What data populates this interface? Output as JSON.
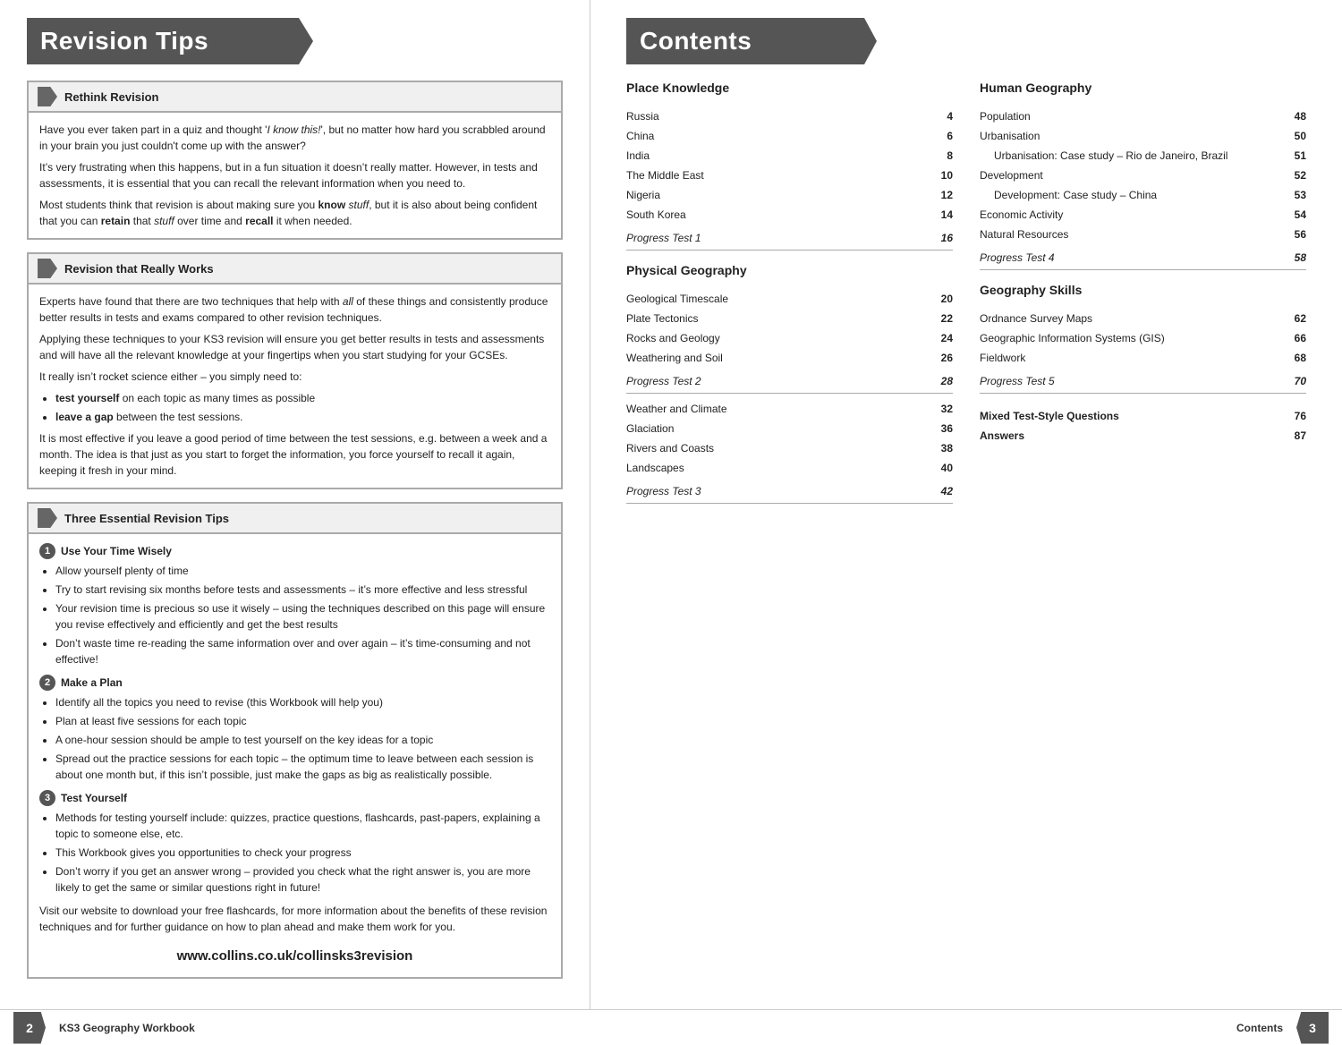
{
  "left_page": {
    "header_title": "Revision Tips",
    "section1": {
      "title": "Rethink Revision",
      "paragraphs": [
        "Have you ever taken part in a quiz and thought ‘I know this!’, but no matter how hard you scrabbled around in your brain you just couldn’t come up with the answer?",
        "It’s very frustrating when this happens, but in a fun situation it doesn’t really matter. However, in tests and assessments, it is essential that you can recall the relevant information when you need to.",
        "Most students think that revision is about making sure you know stuff, but it is also about being confident that you can retain that stuff over time and recall it when needed."
      ]
    },
    "section2": {
      "title": "Revision that Really Works",
      "paragraphs": [
        "Experts have found that there are two techniques that help with all of these things and consistently produce better results in tests and exams compared to other revision techniques.",
        "Applying these techniques to your KS3 revision will ensure you get better results in tests and assessments and will have all the relevant knowledge at your fingertips when you start studying for your GCSEs.",
        "It really isn’t rocket science either – you simply need to:"
      ],
      "bullets": [
        "test yourself on each topic as many times as possible",
        "leave a gap between the test sessions."
      ],
      "paragraph_after": "It is most effective if you leave a good period of time between the test sessions, e.g. between a week and a month. The idea is that just as you start to forget the information, you force yourself to recall it again, keeping it fresh in your mind."
    },
    "section3": {
      "title": "Three Essential Revision Tips",
      "tips": [
        {
          "number": "1",
          "title": "Use Your Time Wisely",
          "bullets": [
            "Allow yourself plenty of time",
            "Try to start revising six months before tests and assessments – it’s more effective and less stressful",
            "Your revision time is precious so use it wisely – using the techniques described on this page will ensure you revise effectively and efficiently and get the best results",
            "Don’t waste time re-reading the same information over and over again – it’s time-consuming and not effective!"
          ]
        },
        {
          "number": "2",
          "title": "Make a Plan",
          "bullets": [
            "Identify all the topics you need to revise (this Workbook will help you)",
            "Plan at least five sessions for each topic",
            "A one-hour session should be ample to test yourself on the key ideas for a topic",
            "Spread out the practice sessions for each topic – the optimum time to leave between each session is about one month but, if this isn’t possible, just make the gaps as big as realistically possible."
          ]
        },
        {
          "number": "3",
          "title": "Test Yourself",
          "bullets": [
            "Methods for testing yourself include: quizzes, practice questions, flashcards, past-papers, explaining a topic to someone else, etc.",
            "This Workbook gives you opportunities to check your progress",
            "Don’t worry if you get an answer wrong – provided you check what the right answer is, you are more likely to get the same or similar questions right in future!"
          ]
        }
      ],
      "footer_text": "Visit our website to download your free flashcards, for more information about the benefits of these revision techniques and for further guidance on how to plan ahead and make them work for you.",
      "website": "www.collins.co.uk/collinsks3revision"
    }
  },
  "right_page": {
    "header_title": "Contents",
    "col_left": {
      "section1_title": "Place Knowledge",
      "place_knowledge_items": [
        {
          "name": "Russia",
          "page": "4"
        },
        {
          "name": "China",
          "page": "6"
        },
        {
          "name": "India",
          "page": "8"
        },
        {
          "name": "The Middle East",
          "page": "10"
        },
        {
          "name": "Nigeria",
          "page": "12"
        },
        {
          "name": "South Korea",
          "page": "14"
        }
      ],
      "progress_test_1": {
        "name": "Progress Test 1",
        "page": "16"
      },
      "section2_title": "Physical Geography",
      "physical_geo_items": [
        {
          "name": "Geological Timescale",
          "page": "20"
        },
        {
          "name": "Plate Tectonics",
          "page": "22"
        },
        {
          "name": "Rocks and Geology",
          "page": "24"
        },
        {
          "name": "Weathering and Soil",
          "page": "26"
        }
      ],
      "progress_test_2": {
        "name": "Progress Test 2",
        "page": "28"
      },
      "physical_geo_items2": [
        {
          "name": "Weather and Climate",
          "page": "32"
        },
        {
          "name": "Glaciation",
          "page": "36"
        },
        {
          "name": "Rivers and Coasts",
          "page": "38"
        },
        {
          "name": "Landscapes",
          "page": "40"
        }
      ],
      "progress_test_3": {
        "name": "Progress Test 3",
        "page": "42"
      }
    },
    "col_right": {
      "section1_title": "Human Geography",
      "human_geo_items": [
        {
          "name": "Population",
          "page": "48"
        },
        {
          "name": "Urbanisation",
          "page": "50"
        },
        {
          "name": "Urbanisation: Case study – Rio de Janeiro, Brazil",
          "page": "51",
          "indented": true
        },
        {
          "name": "Development",
          "page": "52"
        },
        {
          "name": "Development: Case study – China",
          "page": "53",
          "indented": true
        },
        {
          "name": "Economic Activity",
          "page": "54"
        },
        {
          "name": "Natural Resources",
          "page": "56"
        }
      ],
      "progress_test_4": {
        "name": "Progress Test 4",
        "page": "58"
      },
      "section2_title": "Geography Skills",
      "geo_skills_items": [
        {
          "name": "Ordnance Survey Maps",
          "page": "62"
        },
        {
          "name": "Geographic Information Systems (GIS)",
          "page": "66"
        },
        {
          "name": "Fieldwork",
          "page": "68"
        }
      ],
      "progress_test_5": {
        "name": "Progress Test 5",
        "page": "70"
      },
      "mixed_title": "Mixed Test-Style Questions",
      "mixed_page": "76",
      "answers_title": "Answers",
      "answers_page": "87"
    }
  },
  "footer": {
    "left_page_num": "2",
    "left_title": "KS3 Geography Workbook",
    "right_title": "Contents",
    "right_page_num": "3"
  }
}
